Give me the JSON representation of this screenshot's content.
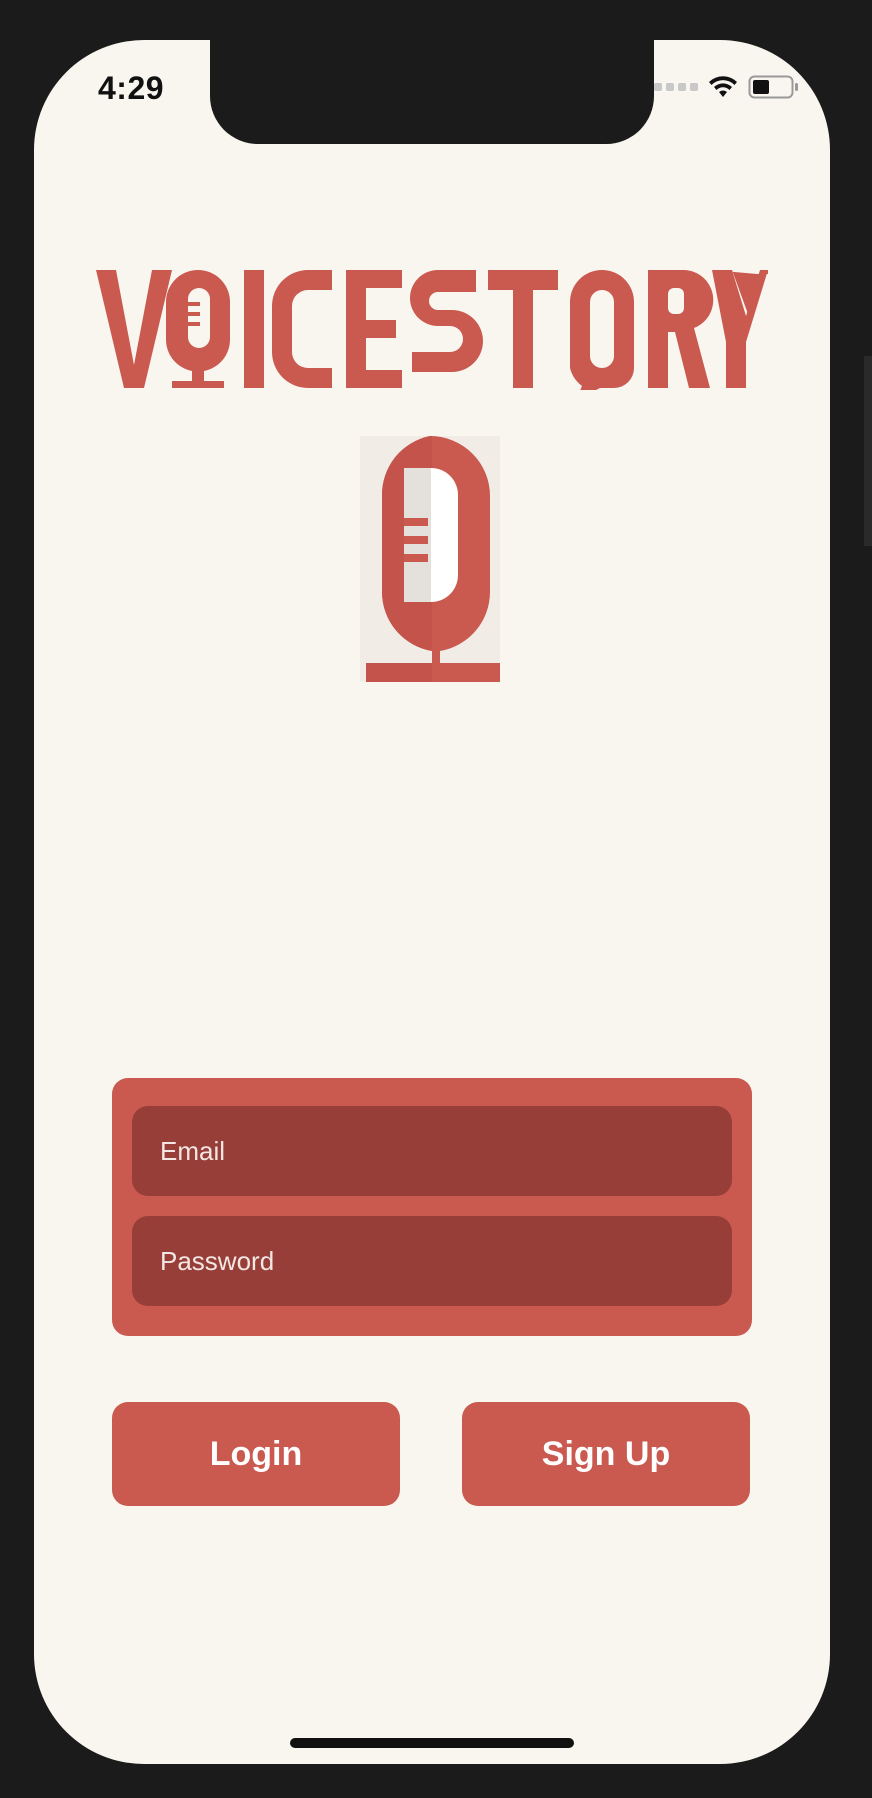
{
  "status_bar": {
    "time": "4:29",
    "icons": [
      "signal-icon",
      "wifi-icon",
      "battery-icon"
    ]
  },
  "brand": {
    "logo_text": "VOICESTORY",
    "color": "#ca5a50"
  },
  "form": {
    "email_placeholder": "Email",
    "password_placeholder": "Password"
  },
  "actions": {
    "login_label": "Login",
    "signup_label": "Sign Up"
  },
  "colors": {
    "background": "#f9f6f0",
    "accent": "#ca5a50",
    "field": "#973e38"
  }
}
